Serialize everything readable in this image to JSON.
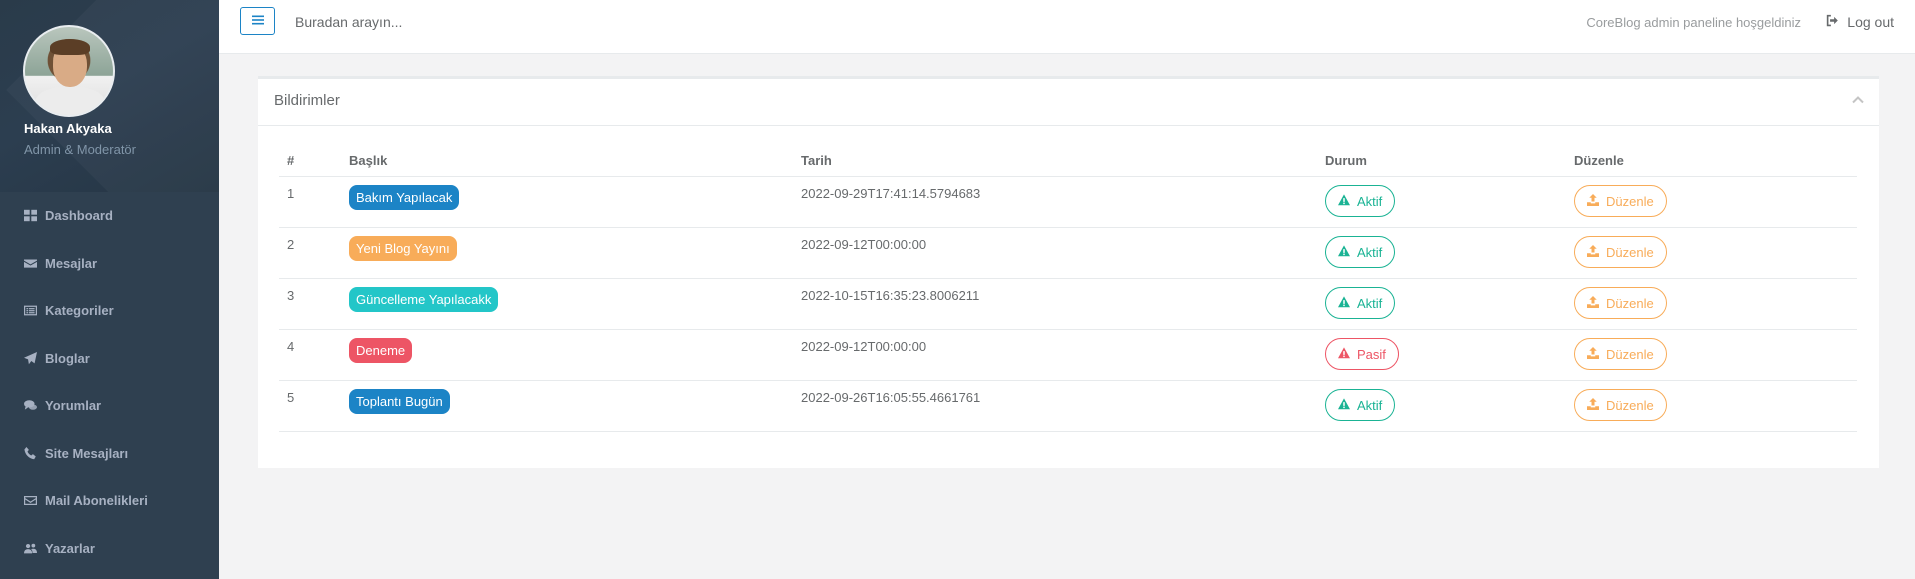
{
  "sidebar": {
    "user_name": "Hakan Akyaka",
    "user_role": "Admin & Moderatör",
    "items": [
      {
        "label": "Dashboard",
        "icon": "th-large-icon"
      },
      {
        "label": "Mesajlar",
        "icon": "envelope-icon"
      },
      {
        "label": "Kategoriler",
        "icon": "list-alt-icon"
      },
      {
        "label": "Bloglar",
        "icon": "paper-plane-icon"
      },
      {
        "label": "Yorumlar",
        "icon": "comments-icon"
      },
      {
        "label": "Site Mesajları",
        "icon": "phone-icon"
      },
      {
        "label": "Mail Abonelikleri",
        "icon": "envelope-outline-icon"
      },
      {
        "label": "Yazarlar",
        "icon": "users-icon"
      }
    ]
  },
  "topbar": {
    "menu_icon": "bars-icon",
    "search_placeholder": "Buradan arayın...",
    "welcome": "CoreBlog admin paneline hoşgeldiniz",
    "logout_label": "Log out"
  },
  "panel": {
    "title": "Bildirimler",
    "columns": {
      "num": "#",
      "title": "Başlık",
      "date": "Tarih",
      "status": "Durum",
      "edit": "Düzenle"
    },
    "rows": [
      {
        "num": "1",
        "title": "Bakım Yapılacak",
        "title_color": "#1c84c6",
        "date": "2022-09-29T17:41:14.5794683",
        "status": "Aktif",
        "edit": "Düzenle"
      },
      {
        "num": "2",
        "title": "Yeni Blog Yayını",
        "title_color": "#f8ac59",
        "date": "2022-09-12T00:00:00",
        "status": "Aktif",
        "edit": "Düzenle"
      },
      {
        "num": "3",
        "title": "Güncelleme Yapılacakk",
        "title_color": "#23c6c8",
        "date": "2022-10-15T16:35:23.8006211",
        "status": "Aktif",
        "edit": "Düzenle"
      },
      {
        "num": "4",
        "title": "Deneme",
        "title_color": "#ed5565",
        "date": "2022-09-12T00:00:00",
        "status": "Pasif",
        "edit": "Düzenle"
      },
      {
        "num": "5",
        "title": "Toplantı Bugün",
        "title_color": "#1c84c6",
        "date": "2022-09-26T16:05:55.4661761",
        "status": "Aktif",
        "edit": "Düzenle"
      }
    ]
  },
  "colors": {
    "sidebar_bg": "#2f4050",
    "active_green": "#1ab394",
    "passive_red": "#ed5565",
    "edit_orange": "#f8ac59"
  }
}
